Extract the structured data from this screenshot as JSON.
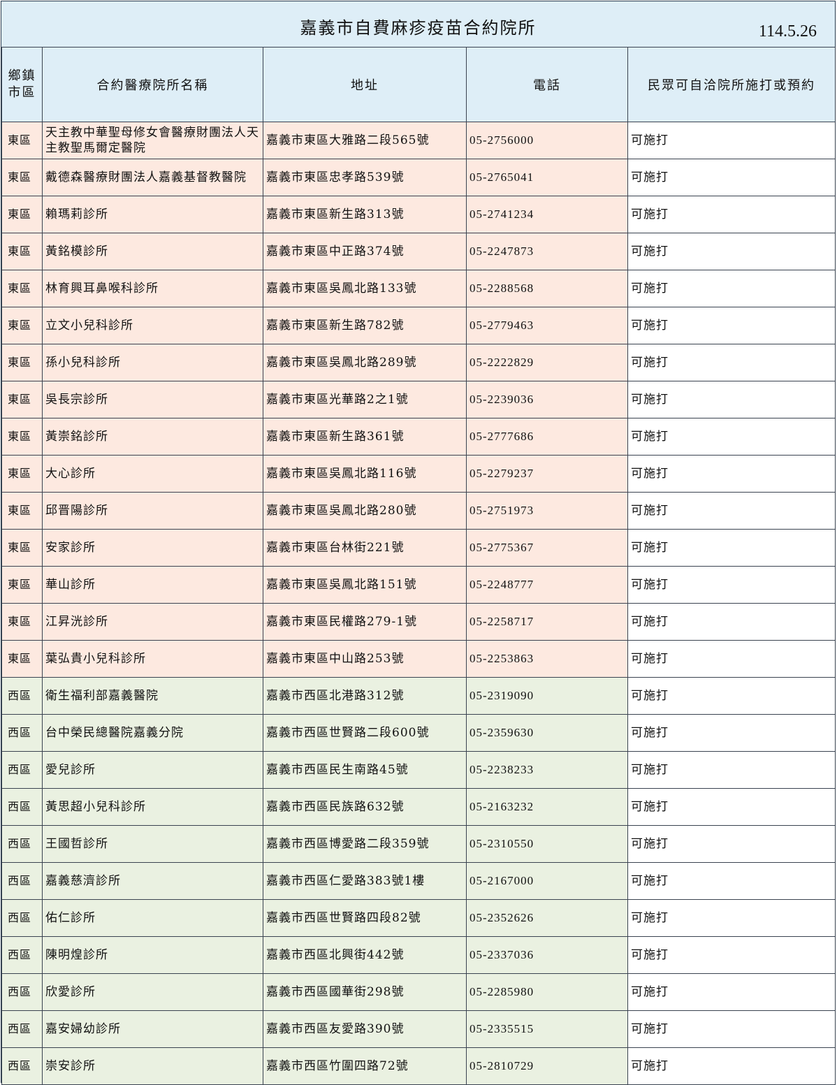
{
  "title": "嘉義市自費麻疹疫苗合約院所",
  "date": "114.5.26",
  "headers": {
    "district_line1": "鄉鎮",
    "district_line2": "市區",
    "name": "合約醫療院所名稱",
    "address": "地址",
    "phone": "電話",
    "note": "民眾可自洽院所施打或預約"
  },
  "rows": [
    {
      "district": "東區",
      "region": "east",
      "name": "天主教中華聖母修女會醫療財團法人天主教聖馬爾定醫院",
      "address": "嘉義市東區大雅路二段565號",
      "phone": "05-2756000",
      "note": "可施打"
    },
    {
      "district": "東區",
      "region": "east",
      "name": "戴德森醫療財團法人嘉義基督教醫院",
      "address": "嘉義市東區忠孝路539號",
      "phone": "05-2765041",
      "note": "可施打"
    },
    {
      "district": "東區",
      "region": "east",
      "name": "賴瑪莉診所",
      "address": "嘉義市東區新生路313號",
      "phone": "05-2741234",
      "note": "可施打"
    },
    {
      "district": "東區",
      "region": "east",
      "name": "黃銘模診所",
      "address": "嘉義市東區中正路374號",
      "phone": "05-2247873",
      "note": "可施打"
    },
    {
      "district": "東區",
      "region": "east",
      "name": "林育興耳鼻喉科診所",
      "address": "嘉義市東區吳鳳北路133號",
      "phone": "05-2288568",
      "note": "可施打"
    },
    {
      "district": "東區",
      "region": "east",
      "name": "立文小兒科診所",
      "address": "嘉義市東區新生路782號",
      "phone": "05-2779463",
      "note": "可施打"
    },
    {
      "district": "東區",
      "region": "east",
      "name": "孫小兒科診所",
      "address": "嘉義市東區吳鳳北路289號",
      "phone": "05-2222829",
      "note": "可施打"
    },
    {
      "district": "東區",
      "region": "east",
      "name": "吳長宗診所",
      "address": "嘉義市東區光華路2之1號",
      "phone": "05-2239036",
      "note": "可施打"
    },
    {
      "district": "東區",
      "region": "east",
      "name": "黃崇銘診所",
      "address": "嘉義市東區新生路361號",
      "phone": "05-2777686",
      "note": "可施打"
    },
    {
      "district": "東區",
      "region": "east",
      "name": "大心診所",
      "address": "嘉義市東區吳鳳北路116號",
      "phone": "05-2279237",
      "note": "可施打"
    },
    {
      "district": "東區",
      "region": "east",
      "name": "邱晋陽診所",
      "address": "嘉義市東區吳鳳北路280號",
      "phone": "05-2751973",
      "note": "可施打"
    },
    {
      "district": "東區",
      "region": "east",
      "name": "安家診所",
      "address": "嘉義市東區台林街221號",
      "phone": "05-2775367",
      "note": "可施打"
    },
    {
      "district": "東區",
      "region": "east",
      "name": "華山診所",
      "address": "嘉義市東區吳鳳北路151號",
      "phone": "05-2248777",
      "note": "可施打"
    },
    {
      "district": "東區",
      "region": "east",
      "name": "江昇洸診所",
      "address": "嘉義市東區民權路279-1號",
      "phone": "05-2258717",
      "note": "可施打"
    },
    {
      "district": "東區",
      "region": "east",
      "name": "葉弘貴小兒科診所",
      "address": "嘉義市東區中山路253號",
      "phone": "05-2253863",
      "note": "可施打"
    },
    {
      "district": "西區",
      "region": "west",
      "name": "衛生福利部嘉義醫院",
      "address": "嘉義市西區北港路312號",
      "phone": "05-2319090",
      "note": "可施打"
    },
    {
      "district": "西區",
      "region": "west",
      "name": "台中榮民總醫院嘉義分院",
      "address": "嘉義市西區世賢路二段600號",
      "phone": "05-2359630",
      "note": "可施打"
    },
    {
      "district": "西區",
      "region": "west",
      "name": "愛兒診所",
      "address": "嘉義市西區民生南路45號",
      "phone": "05-2238233",
      "note": "可施打"
    },
    {
      "district": "西區",
      "region": "west",
      "name": "黃思超小兒科診所",
      "address": "嘉義市西區民族路632號",
      "phone": "05-2163232",
      "note": "可施打"
    },
    {
      "district": "西區",
      "region": "west",
      "name": "王國哲診所",
      "address": "嘉義市西區博愛路二段359號",
      "phone": "05-2310550",
      "note": "可施打"
    },
    {
      "district": "西區",
      "region": "west",
      "name": "嘉義慈濟診所",
      "address": "嘉義市西區仁愛路383號1樓",
      "phone": "05-2167000",
      "note": "可施打"
    },
    {
      "district": "西區",
      "region": "west",
      "name": "佑仁診所",
      "address": "嘉義市西區世賢路四段82號",
      "phone": "05-2352626",
      "note": "可施打"
    },
    {
      "district": "西區",
      "region": "west",
      "name": "陳明煌診所",
      "address": "嘉義市西區北興街442號",
      "phone": "05-2337036",
      "note": "可施打"
    },
    {
      "district": "西區",
      "region": "west",
      "name": "欣愛診所",
      "address": "嘉義市西區國華街298號",
      "phone": "05-2285980",
      "note": "可施打"
    },
    {
      "district": "西區",
      "region": "west",
      "name": "嘉安婦幼診所",
      "address": "嘉義市西區友愛路390號",
      "phone": "05-2335515",
      "note": "可施打"
    },
    {
      "district": "西區",
      "region": "west",
      "name": "崇安診所",
      "address": "嘉義市西區竹圍四路72號",
      "phone": "05-2810729",
      "note": "可施打"
    }
  ],
  "colors": {
    "header_bg": "#deeef7",
    "east_bg": "#fde9e0",
    "west_bg": "#eaf1e1",
    "border": "#3a4350"
  }
}
